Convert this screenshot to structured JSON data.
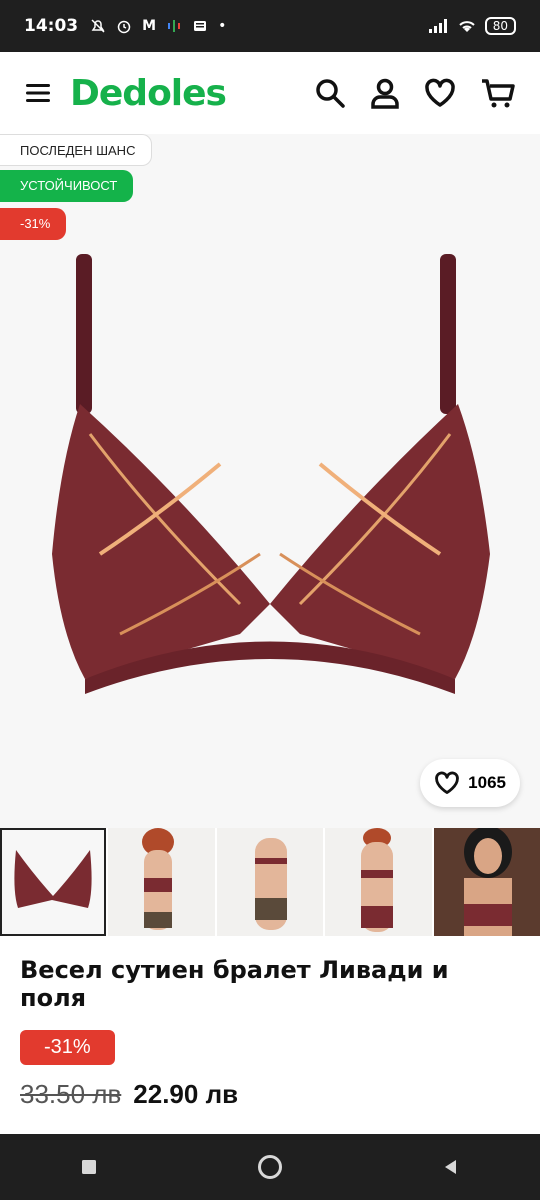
{
  "status_bar": {
    "time": "14:03",
    "battery": "80"
  },
  "header": {
    "logo": "Dedoles"
  },
  "badges": {
    "last_chance": "ПОСЛЕДЕН ШАНС",
    "sustainability": "УСТОЙЧИВОСТ",
    "discount": "-31%"
  },
  "likes": {
    "count": "1065"
  },
  "product": {
    "title": "Весел сутиен бралет Ливади и поля",
    "discount": "-31%",
    "old_price": "33.50 лв",
    "new_price": "22.90 лв"
  },
  "colors": {
    "brand": "#16b14b",
    "discount": "#e23a2e",
    "product": "#7a2b31"
  },
  "icons": [
    "menu-icon",
    "search-icon",
    "user-icon",
    "heart-icon",
    "cart-icon",
    "nav-square-icon",
    "nav-home-icon",
    "nav-back-icon"
  ]
}
